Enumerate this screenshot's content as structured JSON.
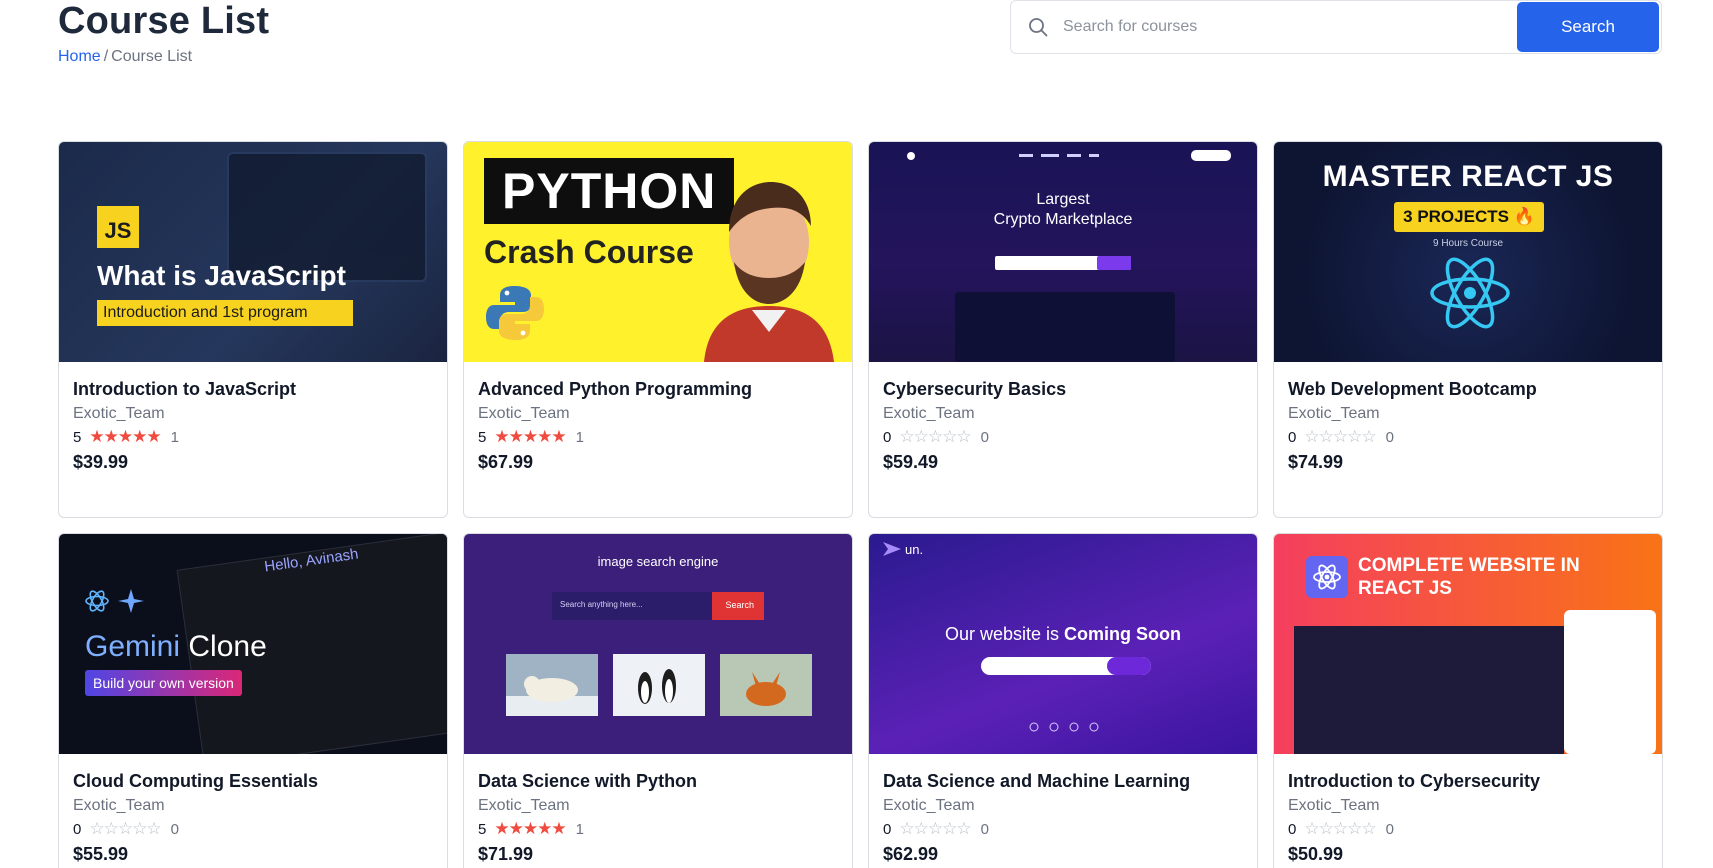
{
  "header": {
    "title": "Course List",
    "breadcrumb": {
      "home": "Home",
      "separator": "/",
      "current": "Course List"
    }
  },
  "search": {
    "placeholder": "Search for courses",
    "value": "",
    "button_label": "Search"
  },
  "colors": {
    "accent": "#2563eb",
    "star_filled": "#ef4b3f",
    "star_empty": "#b8bec6"
  },
  "courses": [
    {
      "title": "Introduction to JavaScript",
      "author": "Exotic_Team",
      "rating": "5",
      "stars": 5,
      "reviews": "1",
      "price": "$39.99",
      "thumb": {
        "badge": "JS",
        "heading": "What is JavaScript",
        "subheading": "Introduction and 1st program"
      }
    },
    {
      "title": "Advanced Python Programming",
      "author": "Exotic_Team",
      "rating": "5",
      "stars": 5,
      "reviews": "1",
      "price": "$67.99",
      "thumb": {
        "heading": "PYTHON",
        "subheading": "Crash Course"
      }
    },
    {
      "title": "Cybersecurity Basics",
      "author": "Exotic_Team",
      "rating": "0",
      "stars": 0,
      "reviews": "0",
      "price": "$59.49",
      "thumb": {
        "heading_line1": "Largest",
        "heading_line2": "Crypto Marketplace"
      }
    },
    {
      "title": "Web Development Bootcamp",
      "author": "Exotic_Team",
      "rating": "0",
      "stars": 0,
      "reviews": "0",
      "price": "$74.99",
      "thumb": {
        "heading": "MASTER REACT JS",
        "pill": "3 PROJECTS 🔥",
        "caption": "9 Hours Course"
      }
    },
    {
      "title": "Cloud Computing Essentials",
      "author": "Exotic_Team",
      "rating": "0",
      "stars": 0,
      "reviews": "0",
      "price": "$55.99",
      "thumb": {
        "greeting": "Hello, Avinash",
        "heading_a": "Gemini",
        "heading_b": "Clone",
        "button": "Build your own version"
      }
    },
    {
      "title": "Data Science with Python",
      "author": "Exotic_Team",
      "rating": "5",
      "stars": 5,
      "reviews": "1",
      "price": "$71.99",
      "thumb": {
        "heading": "image search engine",
        "search_placeholder": "Search anything here...",
        "search_button": "Search"
      }
    },
    {
      "title": "Data Science and Machine Learning",
      "author": "Exotic_Team",
      "rating": "0",
      "stars": 0,
      "reviews": "0",
      "price": "$62.99",
      "thumb": {
        "logo": "un.",
        "heading_a": "Our website is",
        "heading_b": "Coming Soon"
      }
    },
    {
      "title": "Introduction to Cybersecurity",
      "author": "Exotic_Team",
      "rating": "0",
      "stars": 0,
      "reviews": "0",
      "price": "$50.99",
      "thumb": {
        "heading_line1": "COMPLETE WEBSITE IN",
        "heading_line2": "REACT JS"
      }
    }
  ]
}
